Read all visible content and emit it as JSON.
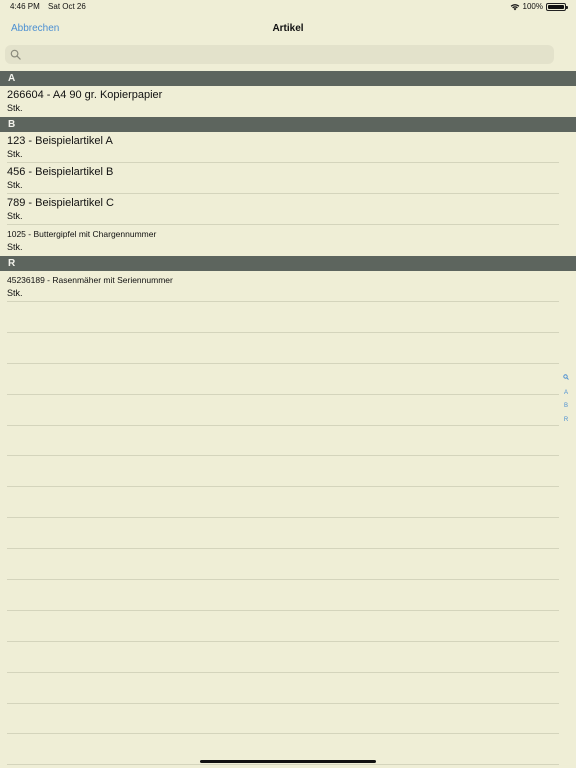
{
  "status_bar": {
    "time": "4:46 PM",
    "date": "Sat Oct 26",
    "battery": "100%"
  },
  "nav": {
    "cancel_label": "Abbrechen",
    "title": "Artikel"
  },
  "search": {
    "placeholder": ""
  },
  "sections": [
    {
      "letter": "A",
      "items": [
        {
          "title": "266604 - A4 90 gr. Kopierpapier",
          "unit": "Stk.",
          "size": "big"
        }
      ]
    },
    {
      "letter": "B",
      "items": [
        {
          "title": "123 - Beispielartikel A",
          "unit": "Stk.",
          "size": "big"
        },
        {
          "title": "456 - Beispielartikel B",
          "unit": "Stk.",
          "size": "big"
        },
        {
          "title": "789 - Beispielartikel C",
          "unit": "Stk.",
          "size": "big"
        },
        {
          "title": "1025 - Buttergipfel mit Chargennummer",
          "unit": "Stk.",
          "size": "small"
        }
      ]
    },
    {
      "letter": "R",
      "items": [
        {
          "title": "45236189 - Rasenmäher mit Seriennummer",
          "unit": "Stk.",
          "size": "small"
        }
      ]
    }
  ],
  "index": {
    "search_icon": "search-icon",
    "letters": [
      "A",
      "B",
      "R"
    ]
  },
  "colors": {
    "background": "#efeed6",
    "section_header": "#5d655e",
    "accent": "#4b8fd2"
  }
}
